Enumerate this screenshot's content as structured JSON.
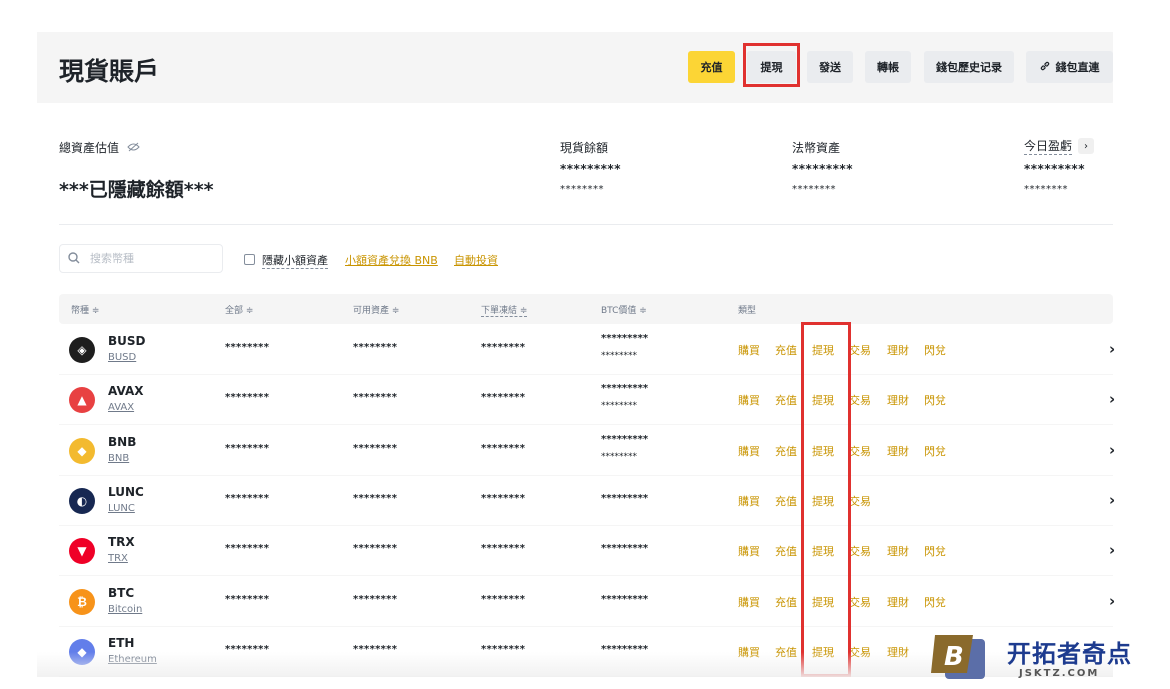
{
  "header": {
    "title": "現貨賬戶",
    "buttons": {
      "deposit": "充值",
      "withdraw": "提現",
      "send": "發送",
      "transfer": "轉帳",
      "history": "錢包歷史记录",
      "connect": "錢包直連"
    }
  },
  "summary": {
    "total_label": "總資產估值",
    "hidden_text": "***已隱藏餘額***",
    "spot_label": "現貨餘額",
    "fiat_label": "法幣資產",
    "pnl_label": "今日盈虧",
    "masked_big": "*********",
    "masked_small": "********"
  },
  "filters": {
    "search_placeholder": "搜索幣種",
    "hide_small": "隱藏小額資產",
    "convert_small": "小額資產兌換 BNB",
    "auto_invest": "自動投資"
  },
  "table": {
    "headers": {
      "coin": "幣種 ≑",
      "total": "全部 ≑",
      "available": "可用資產 ≑",
      "in_order": "下單凍結 ≑",
      "btc_value": "BTC價值 ≑",
      "type": "類型"
    },
    "masked_value": "********",
    "masked_btc": "*********",
    "masked_btc_small": "********",
    "actions": {
      "buy": "購買",
      "deposit": "充值",
      "withdraw": "提現",
      "trade": "交易",
      "earn": "理財",
      "convert": "閃兌"
    },
    "rows": [
      {
        "symbol": "BUSD",
        "name": "BUSD",
        "icon": "busd-icon",
        "color": "#1e1e1e"
      },
      {
        "symbol": "AVAX",
        "name": "AVAX",
        "icon": "avax-icon",
        "color": "#e84142"
      },
      {
        "symbol": "BNB",
        "name": "BNB",
        "icon": "bnb-icon",
        "color": "#f3ba2f"
      },
      {
        "symbol": "LUNC",
        "name": "LUNC",
        "icon": "lunc-icon",
        "color": "#172852"
      },
      {
        "symbol": "TRX",
        "name": "TRX",
        "icon": "trx-icon",
        "color": "#ef0027"
      },
      {
        "symbol": "BTC",
        "name": "Bitcoin",
        "icon": "btc-icon",
        "color": "#f7931a"
      },
      {
        "symbol": "ETH",
        "name": "Ethereum",
        "icon": "eth-icon",
        "color": "#627eea"
      }
    ]
  },
  "watermark": {
    "text": "开拓者奇点",
    "url": "JSKTZ.COM",
    "logo_letter": "B"
  },
  "colors": {
    "brand_yellow": "#fcd535",
    "link_gold": "#c99400",
    "highlight_red": "#e0312f"
  }
}
